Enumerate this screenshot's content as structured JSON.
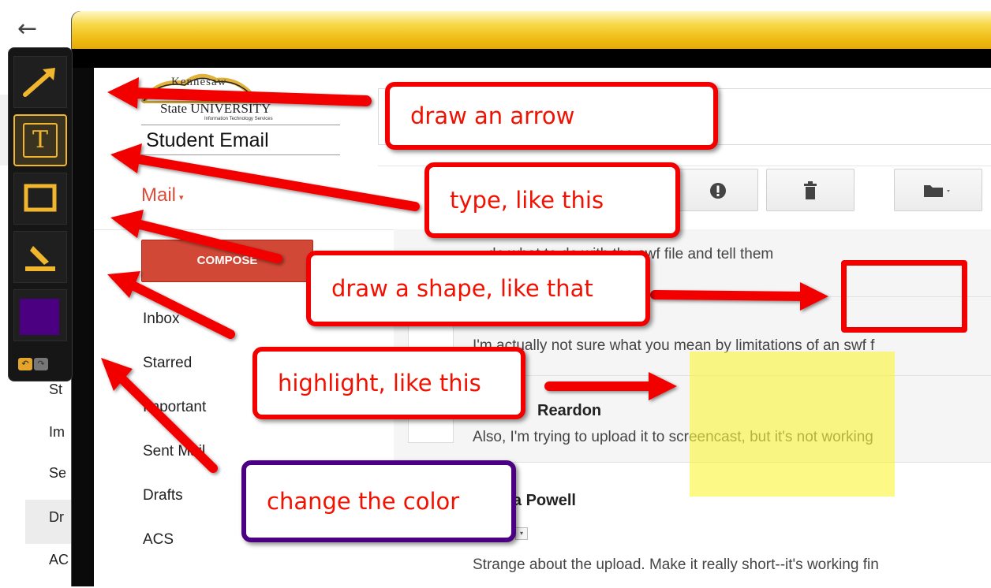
{
  "background_window": {
    "back_icon": "←",
    "sidebar_items": [
      "St",
      "Im",
      "Se",
      "Dr",
      "AC"
    ]
  },
  "gmail": {
    "logo": {
      "arch_text": "Kennesaw",
      "university_text": "State UNIVERSITY",
      "its_text": "Information Technology Services",
      "product_text": "Student Email"
    },
    "mail_label": "Mail",
    "mail_caret": "▾",
    "compose_label": "COMPOSE",
    "nav_items": [
      "Inbox",
      "Starred",
      "Important",
      "Sent Mail",
      "Drafts",
      "ACS"
    ],
    "toolbar": {
      "report_icon": "!",
      "delete_icon": "trash-icon",
      "move_icon": "folder-icon"
    },
    "messages": [
      {
        "text": "…de what to do with the swf file and tell them"
      },
      {
        "text": "I'm actually not sure what you mean by limitations of an swf f"
      },
      {
        "sender": "Reardon",
        "text": "Also, I'm trying to upload it to screencast, but it's not working"
      },
      {
        "sender": "ara Powell",
        "sender_line2": "e",
        "text": "Strange about the upload. Make it really short--it's working fin"
      }
    ]
  },
  "annotation_toolbar": {
    "tools": [
      "arrow-tool",
      "text-tool",
      "shape-tool",
      "highlight-tool"
    ],
    "text_tool_glyph": "T",
    "selected_color": "#4b0082",
    "accent": "#f0b62e",
    "undo_glyph": "↶",
    "redo_glyph": "↷"
  },
  "callouts": {
    "arrow": "draw an arrow",
    "type": "type, like this",
    "shape": "draw a shape, like that",
    "highlight": "highlight, like this",
    "color": "change the color"
  },
  "colors": {
    "annotation_red": "#f20000",
    "callout_purple": "#4b0082",
    "highlight_yellow": "#faf53c",
    "gmail_red": "#dd4b39"
  }
}
